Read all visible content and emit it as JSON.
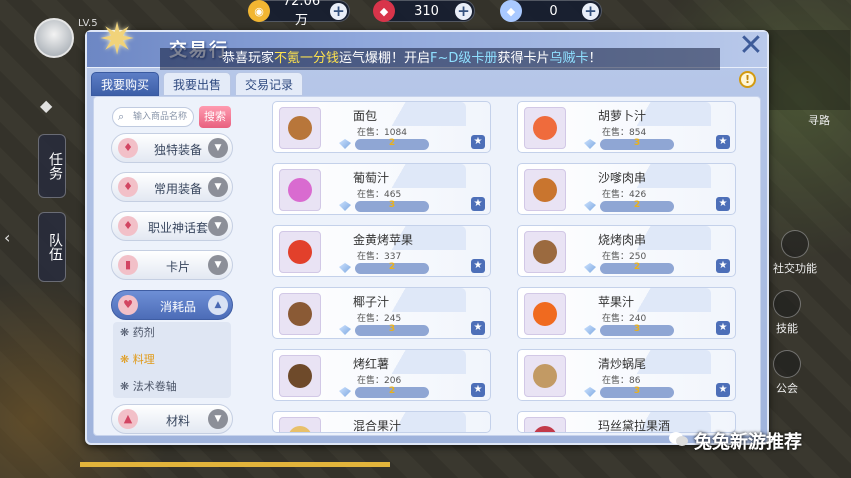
{
  "hud": {
    "currency": [
      {
        "value": "72.06万",
        "icon": "gold-coin-icon",
        "color": "#f2b632"
      },
      {
        "value": "310",
        "icon": "red-crystal-icon",
        "color": "#d8344a"
      },
      {
        "value": "0",
        "icon": "blue-gem-icon",
        "color": "#a9c9ff"
      }
    ],
    "level": "LV.5",
    "left_tabs": [
      "任务",
      "队伍"
    ]
  },
  "panel": {
    "title": "交易行",
    "announcement": {
      "prefix": "恭喜玩家",
      "highlight1": "不氪一分钱",
      "mid": "运气爆棚！开启",
      "highlight2": "F~D级卡册",
      "mid2": "获得卡片",
      "highlight3": "乌贼卡",
      "suffix": "！"
    },
    "tabs": [
      "我要购买",
      "我要出售",
      "交易记录"
    ],
    "active_tab": 0,
    "search": {
      "placeholder": "输入商品名称",
      "button": "搜索"
    },
    "categories": [
      {
        "label": "独特装备",
        "icon": "shirt-icon"
      },
      {
        "label": "常用装备",
        "icon": "shirt-icon"
      },
      {
        "label": "职业神话套",
        "icon": "shirt-icon"
      },
      {
        "label": "卡片",
        "icon": "card-icon"
      },
      {
        "label": "消耗品",
        "icon": "potion-icon",
        "open": true
      },
      {
        "label": "材料",
        "icon": "material-icon"
      }
    ],
    "subcategories": [
      {
        "label": "药剂",
        "selected": false
      },
      {
        "label": "料理",
        "selected": true
      },
      {
        "label": "法术卷轴",
        "selected": false
      }
    ],
    "stock_prefix": "在售：",
    "items": [
      {
        "name": "面包",
        "stock": "1084",
        "price": "2",
        "icon": "bread-icon",
        "color": "#b8763a"
      },
      {
        "name": "胡萝卜汁",
        "stock": "854",
        "price": "3",
        "icon": "carrot-juice-icon",
        "color": "#ef6b3c"
      },
      {
        "name": "葡萄汁",
        "stock": "465",
        "price": "3",
        "icon": "grape-juice-icon",
        "color": "#d96bd0"
      },
      {
        "name": "沙嗲肉串",
        "stock": "426",
        "price": "2",
        "icon": "satay-icon",
        "color": "#c9752e"
      },
      {
        "name": "金黄烤苹果",
        "stock": "337",
        "price": "2",
        "icon": "baked-apple-icon",
        "color": "#e2402b"
      },
      {
        "name": "烧烤肉串",
        "stock": "250",
        "price": "2",
        "icon": "skewer-icon",
        "color": "#9b6a3f"
      },
      {
        "name": "椰子汁",
        "stock": "245",
        "price": "3",
        "icon": "coconut-juice-icon",
        "color": "#8a5a35"
      },
      {
        "name": "苹果汁",
        "stock": "240",
        "price": "3",
        "icon": "apple-juice-icon",
        "color": "#f06a1f"
      },
      {
        "name": "烤红薯",
        "stock": "206",
        "price": "2",
        "icon": "sweet-potato-icon",
        "color": "#6e4a2a"
      },
      {
        "name": "清炒蜗尾",
        "stock": "86",
        "price": "3",
        "icon": "snail-dish-icon",
        "color": "#c29a64"
      },
      {
        "name": "混合果汁",
        "stock": "",
        "price": "",
        "icon": "mixed-juice-icon",
        "color": "#e8c06a"
      },
      {
        "name": "玛丝黛拉果酒",
        "stock": "",
        "price": "",
        "icon": "wine-icon",
        "color": "#c23a4a"
      }
    ]
  },
  "right_hud": [
    "寻路",
    "社交功能",
    "技能",
    "公会"
  ],
  "watermark": "兔兔新游推荐"
}
